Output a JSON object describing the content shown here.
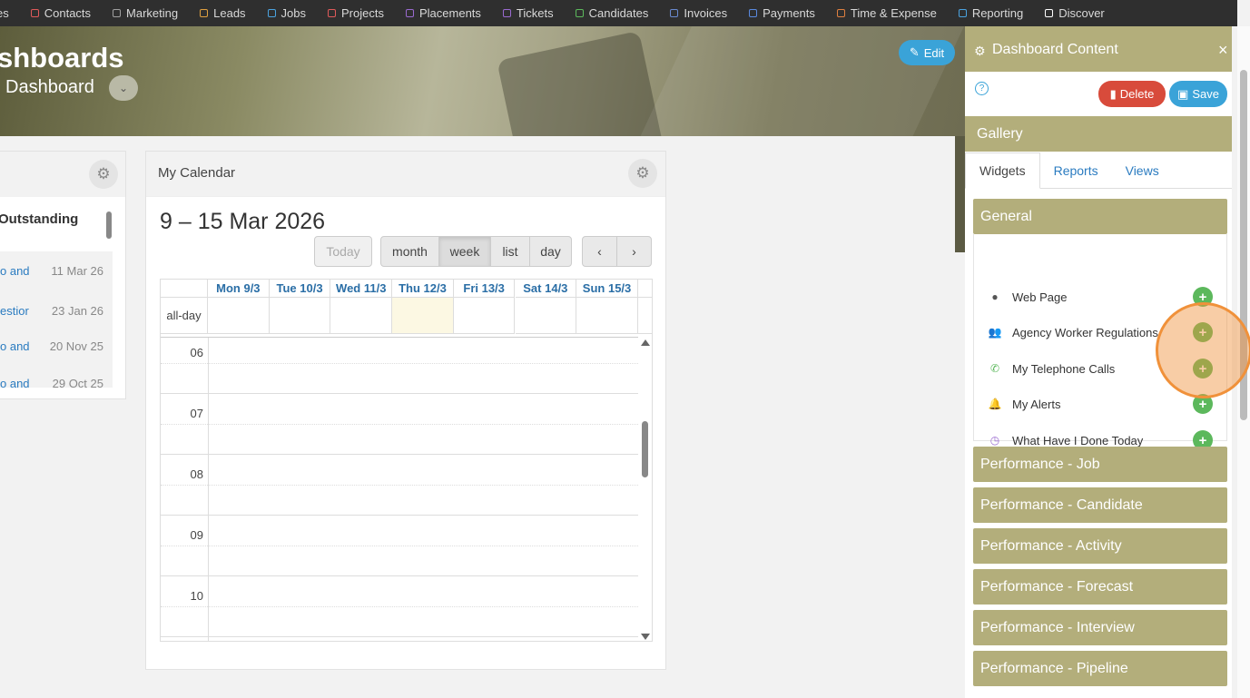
{
  "nav": {
    "items": [
      "es",
      "Contacts",
      "Marketing",
      "Leads",
      "Jobs",
      "Projects",
      "Placements",
      "Tickets",
      "Candidates",
      "Invoices",
      "Payments",
      "Time & Expense",
      "Reporting",
      "Discover"
    ],
    "colors": [
      "#d9d9d9",
      "#e05a5a",
      "#a0a0a0",
      "#e0a040",
      "#4aa3e0",
      "#e05a5a",
      "#9a6ad0",
      "#9a6ad0",
      "#5cb85c",
      "#6a8ad0",
      "#5a8ae0",
      "#e08040",
      "#4aa3e0",
      "#ffffff"
    ]
  },
  "hero": {
    "title": "shboards",
    "subtitle": "Dashboard",
    "dropdown_icon": "⌄",
    "edit_label": "Edit"
  },
  "left_widget": {
    "title": "Outstanding",
    "rows": [
      {
        "link": "o and",
        "date": "11 Mar 26"
      },
      {
        "link": "estior",
        "date": "23 Jan 26"
      },
      {
        "link": "o and",
        "date": "20 Nov 25"
      },
      {
        "link": "o and",
        "date": "29 Oct 25"
      }
    ]
  },
  "calendar": {
    "title": "My Calendar",
    "range": "9 – 15 Mar 2026",
    "today_label": "Today",
    "views": [
      "month",
      "week",
      "list",
      "day"
    ],
    "active_view": "week",
    "prev": "‹",
    "next": "›",
    "days": [
      "Mon 9/3",
      "Tue 10/3",
      "Wed 11/3",
      "Thu 12/3",
      "Fri 13/3",
      "Sat 14/3",
      "Sun 15/3"
    ],
    "today_index": 3,
    "allday_label": "all-day",
    "hours": [
      "06",
      "07",
      "08",
      "09",
      "10"
    ]
  },
  "panel": {
    "title": "Dashboard Content",
    "close": "×",
    "help": "?",
    "delete_label": "Delete",
    "save_label": "Save",
    "gallery_label": "Gallery",
    "tabs": [
      "Widgets",
      "Reports",
      "Views"
    ],
    "active_tab": "Widgets",
    "general_label": "General",
    "general_items": [
      {
        "label": "Web Page",
        "icon": "globe-icon",
        "glyph": "●",
        "color": "#555555"
      },
      {
        "label": "Agency Worker Regulations",
        "icon": "users-icon",
        "glyph": "👥",
        "color": "#555555"
      },
      {
        "label": "My Telephone Calls",
        "icon": "phone-icon",
        "glyph": "✆",
        "color": "#5cb85c"
      },
      {
        "label": "My Alerts",
        "icon": "bell-icon",
        "glyph": "🔔",
        "color": "#3aa3d8"
      },
      {
        "label": "What Have I Done Today",
        "icon": "clock-icon",
        "glyph": "◷",
        "color": "#9a6ad0"
      }
    ],
    "sections": [
      "Performance - Job",
      "Performance - Candidate",
      "Performance - Activity",
      "Performance - Forecast",
      "Performance - Interview",
      "Performance - Pipeline"
    ]
  },
  "colors": {
    "accent_olive": "#b3ae7b",
    "add_green": "#5cb85c",
    "delete_red": "#d84b3b",
    "save_blue": "#3aa3d8",
    "highlight_orange": "#f0913a"
  }
}
